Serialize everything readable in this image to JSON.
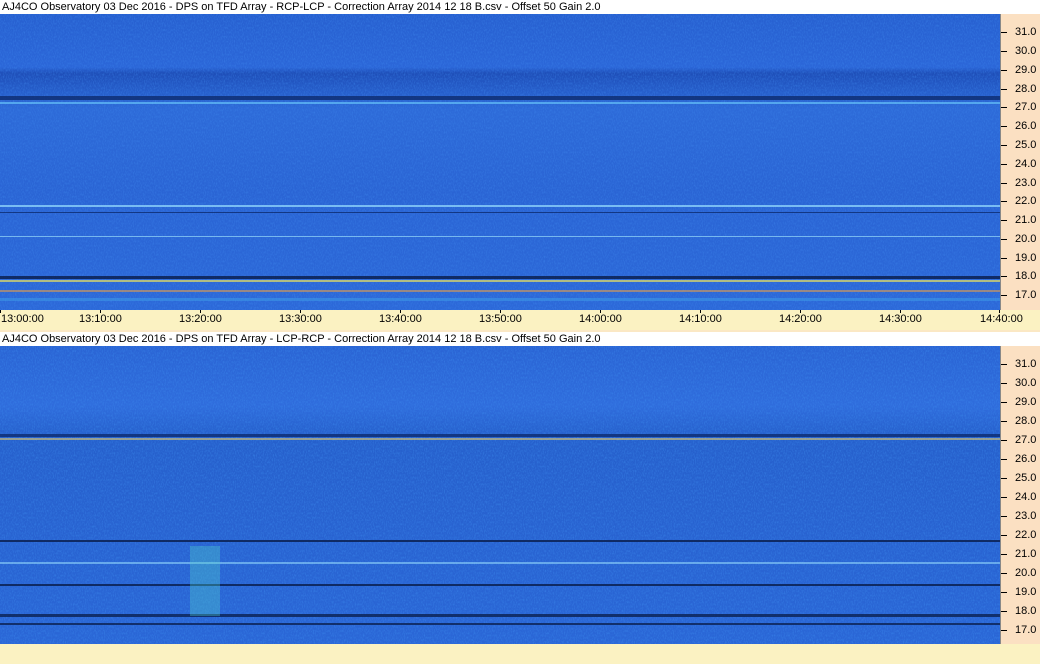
{
  "panels": [
    {
      "title": "AJ4CO Observatory 03 Dec 2016  -  DPS on TFD Array  -  RCP-LCP  -  Correction Array 2014 12 18 B.csv  -  Offset 50  Gain 2.0",
      "y_labels": [
        "31.0",
        "30.0",
        "29.0",
        "28.0",
        "27.0",
        "26.0",
        "25.0",
        "24.0",
        "23.0",
        "22.0",
        "21.0",
        "20.0",
        "19.0",
        "18.0",
        "17.0"
      ],
      "x_labels": [
        "13:00:00",
        "13:10:00",
        "13:20:00",
        "13:30:00",
        "13:40:00",
        "13:50:00",
        "14:00:00",
        "14:10:00",
        "14:20:00",
        "14:30:00",
        "14:40:00"
      ]
    },
    {
      "title": "AJ4CO Observatory 03 Dec 2016  -  DPS on TFD Array  -  LCP-RCP  -  Correction Array 2014 12 18 B.csv  -  Offset 50  Gain 2.0",
      "y_labels": [
        "31.0",
        "30.0",
        "29.0",
        "28.0",
        "27.0",
        "26.0",
        "25.0",
        "24.0",
        "23.0",
        "22.0",
        "21.0",
        "20.0",
        "19.0",
        "18.0",
        "17.0"
      ],
      "x_labels": []
    }
  ],
  "colors": {
    "background": "#2a64d6",
    "axis_panel": "#fbe0c2",
    "time_axis": "#fbf2c2"
  }
}
